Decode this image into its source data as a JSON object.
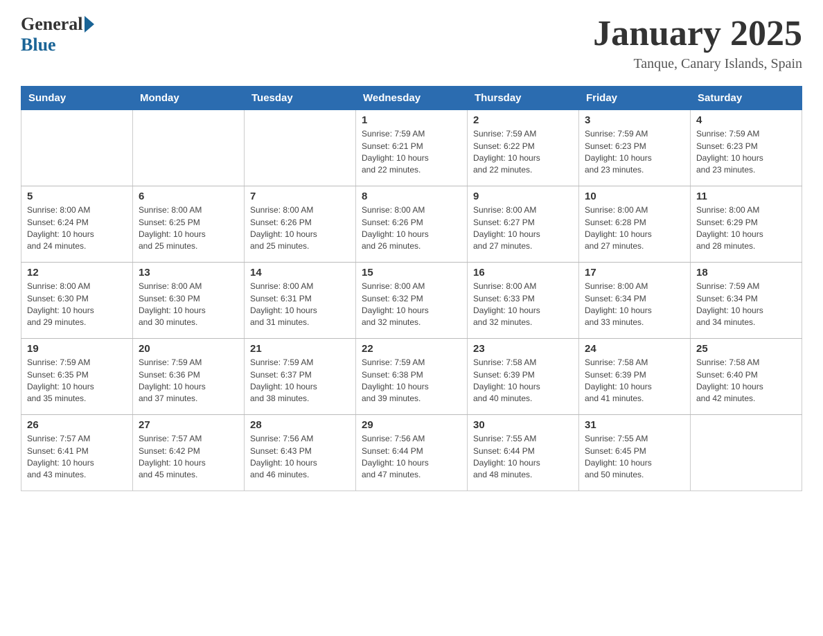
{
  "header": {
    "logo_general": "General",
    "logo_blue": "Blue",
    "month_title": "January 2025",
    "location": "Tanque, Canary Islands, Spain"
  },
  "days_of_week": [
    "Sunday",
    "Monday",
    "Tuesday",
    "Wednesday",
    "Thursday",
    "Friday",
    "Saturday"
  ],
  "weeks": [
    [
      {
        "day": "",
        "info": ""
      },
      {
        "day": "",
        "info": ""
      },
      {
        "day": "",
        "info": ""
      },
      {
        "day": "1",
        "info": "Sunrise: 7:59 AM\nSunset: 6:21 PM\nDaylight: 10 hours\nand 22 minutes."
      },
      {
        "day": "2",
        "info": "Sunrise: 7:59 AM\nSunset: 6:22 PM\nDaylight: 10 hours\nand 22 minutes."
      },
      {
        "day": "3",
        "info": "Sunrise: 7:59 AM\nSunset: 6:23 PM\nDaylight: 10 hours\nand 23 minutes."
      },
      {
        "day": "4",
        "info": "Sunrise: 7:59 AM\nSunset: 6:23 PM\nDaylight: 10 hours\nand 23 minutes."
      }
    ],
    [
      {
        "day": "5",
        "info": "Sunrise: 8:00 AM\nSunset: 6:24 PM\nDaylight: 10 hours\nand 24 minutes."
      },
      {
        "day": "6",
        "info": "Sunrise: 8:00 AM\nSunset: 6:25 PM\nDaylight: 10 hours\nand 25 minutes."
      },
      {
        "day": "7",
        "info": "Sunrise: 8:00 AM\nSunset: 6:26 PM\nDaylight: 10 hours\nand 25 minutes."
      },
      {
        "day": "8",
        "info": "Sunrise: 8:00 AM\nSunset: 6:26 PM\nDaylight: 10 hours\nand 26 minutes."
      },
      {
        "day": "9",
        "info": "Sunrise: 8:00 AM\nSunset: 6:27 PM\nDaylight: 10 hours\nand 27 minutes."
      },
      {
        "day": "10",
        "info": "Sunrise: 8:00 AM\nSunset: 6:28 PM\nDaylight: 10 hours\nand 27 minutes."
      },
      {
        "day": "11",
        "info": "Sunrise: 8:00 AM\nSunset: 6:29 PM\nDaylight: 10 hours\nand 28 minutes."
      }
    ],
    [
      {
        "day": "12",
        "info": "Sunrise: 8:00 AM\nSunset: 6:30 PM\nDaylight: 10 hours\nand 29 minutes."
      },
      {
        "day": "13",
        "info": "Sunrise: 8:00 AM\nSunset: 6:30 PM\nDaylight: 10 hours\nand 30 minutes."
      },
      {
        "day": "14",
        "info": "Sunrise: 8:00 AM\nSunset: 6:31 PM\nDaylight: 10 hours\nand 31 minutes."
      },
      {
        "day": "15",
        "info": "Sunrise: 8:00 AM\nSunset: 6:32 PM\nDaylight: 10 hours\nand 32 minutes."
      },
      {
        "day": "16",
        "info": "Sunrise: 8:00 AM\nSunset: 6:33 PM\nDaylight: 10 hours\nand 32 minutes."
      },
      {
        "day": "17",
        "info": "Sunrise: 8:00 AM\nSunset: 6:34 PM\nDaylight: 10 hours\nand 33 minutes."
      },
      {
        "day": "18",
        "info": "Sunrise: 7:59 AM\nSunset: 6:34 PM\nDaylight: 10 hours\nand 34 minutes."
      }
    ],
    [
      {
        "day": "19",
        "info": "Sunrise: 7:59 AM\nSunset: 6:35 PM\nDaylight: 10 hours\nand 35 minutes."
      },
      {
        "day": "20",
        "info": "Sunrise: 7:59 AM\nSunset: 6:36 PM\nDaylight: 10 hours\nand 37 minutes."
      },
      {
        "day": "21",
        "info": "Sunrise: 7:59 AM\nSunset: 6:37 PM\nDaylight: 10 hours\nand 38 minutes."
      },
      {
        "day": "22",
        "info": "Sunrise: 7:59 AM\nSunset: 6:38 PM\nDaylight: 10 hours\nand 39 minutes."
      },
      {
        "day": "23",
        "info": "Sunrise: 7:58 AM\nSunset: 6:39 PM\nDaylight: 10 hours\nand 40 minutes."
      },
      {
        "day": "24",
        "info": "Sunrise: 7:58 AM\nSunset: 6:39 PM\nDaylight: 10 hours\nand 41 minutes."
      },
      {
        "day": "25",
        "info": "Sunrise: 7:58 AM\nSunset: 6:40 PM\nDaylight: 10 hours\nand 42 minutes."
      }
    ],
    [
      {
        "day": "26",
        "info": "Sunrise: 7:57 AM\nSunset: 6:41 PM\nDaylight: 10 hours\nand 43 minutes."
      },
      {
        "day": "27",
        "info": "Sunrise: 7:57 AM\nSunset: 6:42 PM\nDaylight: 10 hours\nand 45 minutes."
      },
      {
        "day": "28",
        "info": "Sunrise: 7:56 AM\nSunset: 6:43 PM\nDaylight: 10 hours\nand 46 minutes."
      },
      {
        "day": "29",
        "info": "Sunrise: 7:56 AM\nSunset: 6:44 PM\nDaylight: 10 hours\nand 47 minutes."
      },
      {
        "day": "30",
        "info": "Sunrise: 7:55 AM\nSunset: 6:44 PM\nDaylight: 10 hours\nand 48 minutes."
      },
      {
        "day": "31",
        "info": "Sunrise: 7:55 AM\nSunset: 6:45 PM\nDaylight: 10 hours\nand 50 minutes."
      },
      {
        "day": "",
        "info": ""
      }
    ]
  ]
}
